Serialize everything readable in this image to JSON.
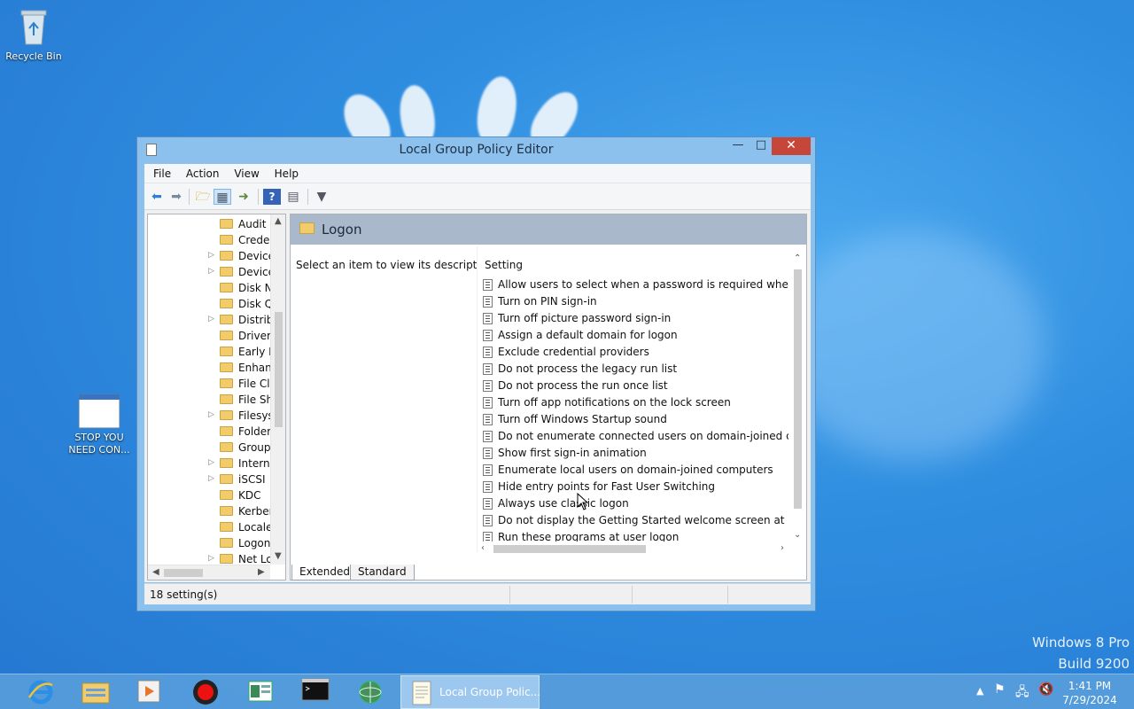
{
  "desktop": {
    "icons": [
      {
        "name": "recycle-bin",
        "label": "Recycle Bin"
      },
      {
        "name": "stop-you-need-con",
        "label_line1": "STOP YOU",
        "label_line2": "NEED CON..."
      }
    ],
    "watermark": {
      "line1": "Windows 8 Pro",
      "line2": "Build 9200"
    }
  },
  "window": {
    "title": "Local Group Policy Editor",
    "menu": [
      "File",
      "Action",
      "View",
      "Help"
    ],
    "tree": {
      "items": [
        {
          "label": "Audit P",
          "expandable": false
        },
        {
          "label": "Creden",
          "expandable": false
        },
        {
          "label": "Device",
          "expandable": true
        },
        {
          "label": "Device",
          "expandable": true
        },
        {
          "label": "Disk N",
          "expandable": false
        },
        {
          "label": "Disk Q",
          "expandable": false
        },
        {
          "label": "Distrib",
          "expandable": true
        },
        {
          "label": "Driver",
          "expandable": false
        },
        {
          "label": "Early L",
          "expandable": false
        },
        {
          "label": "Enhanc",
          "expandable": false
        },
        {
          "label": "File Cla",
          "expandable": false
        },
        {
          "label": "File Sh",
          "expandable": false
        },
        {
          "label": "Filesys",
          "expandable": true
        },
        {
          "label": "Folder",
          "expandable": false
        },
        {
          "label": "Group",
          "expandable": false
        },
        {
          "label": "Interne",
          "expandable": true
        },
        {
          "label": "iSCSI",
          "expandable": true
        },
        {
          "label": "KDC",
          "expandable": false
        },
        {
          "label": "Kerber",
          "expandable": false
        },
        {
          "label": "Locale",
          "expandable": false
        },
        {
          "label": "Logon",
          "expandable": false
        },
        {
          "label": "Net Lo",
          "expandable": true
        }
      ]
    },
    "pane": {
      "heading": "Logon",
      "description": "Select an item to view its description.",
      "column_header": "Setting",
      "settings": [
        "Allow users to select when a password is required when resu...",
        "Turn on PIN sign-in",
        "Turn off picture password sign-in",
        "Assign a default domain for logon",
        "Exclude credential providers",
        "Do not process the legacy run list",
        "Do not process the run once list",
        "Turn off app notifications on the lock screen",
        "Turn off Windows Startup sound",
        "Do not enumerate connected users on domain-joined com...",
        "Show first sign-in animation",
        "Enumerate local users on domain-joined computers",
        "Hide entry points for Fast User Switching",
        "Always use classic logon",
        "Do not display the Getting Started welcome screen at logon",
        "Run these programs at user logon"
      ]
    },
    "tabs": [
      "Extended",
      "Standard"
    ],
    "status": "18 setting(s)"
  },
  "taskbar": {
    "active_window_label": "Local Group Polic...",
    "clock_time": "1:41 PM",
    "clock_date": "7/29/2024"
  }
}
